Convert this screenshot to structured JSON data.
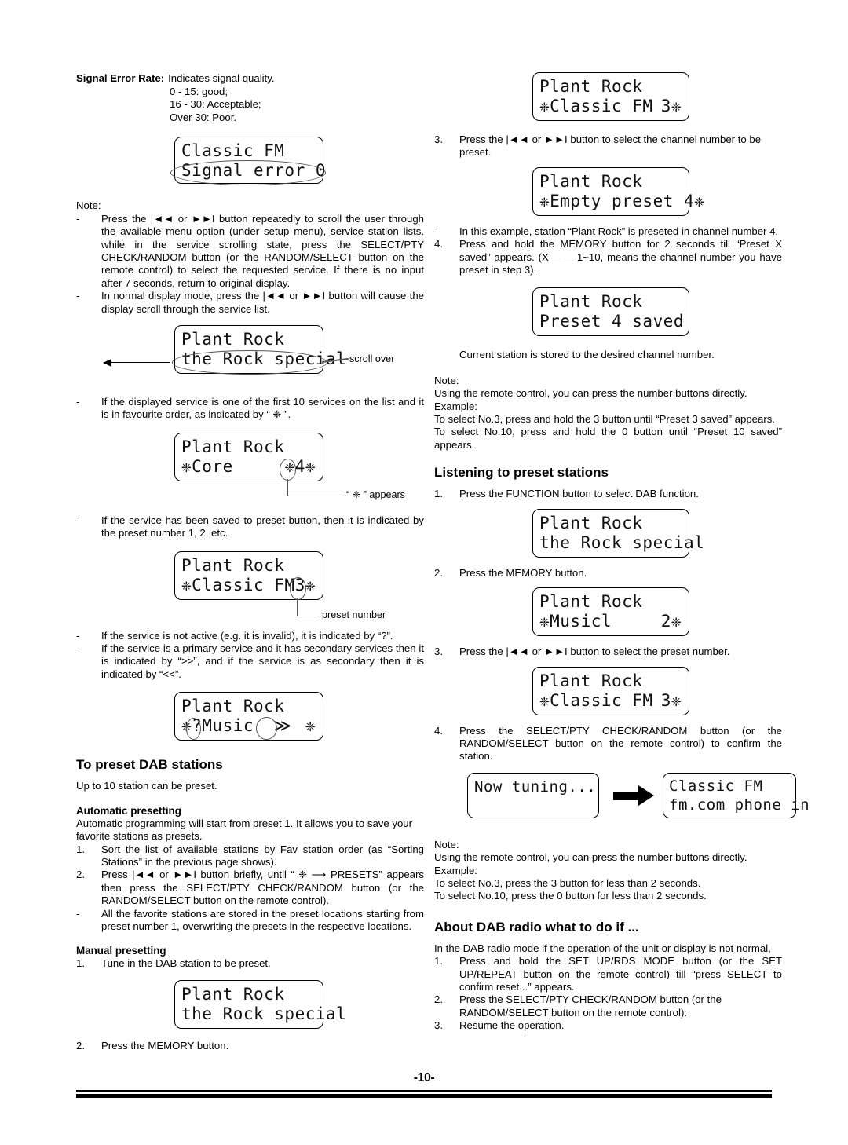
{
  "page": {
    "number": "-10-"
  },
  "left": {
    "signal_error": {
      "term": "Signal Error Rate:",
      "def_line1": "Indicates signal quality.",
      "def_line2": "0 - 15: good;",
      "def_line3": "16 - 30: Acceptable;",
      "def_line4": "Over 30: Poor."
    },
    "lcd_signal_error": {
      "line1": "Classic FM",
      "line2": "Signal error 0"
    },
    "note_label": "Note:",
    "note_items": [
      {
        "marker": "-",
        "text": "Press the |◄◄ or ►►I button repeatedly to scroll the user through the available menu option (under setup menu), service station lists. while in the service scrolling state, press the SELECT/PTY CHECK/RANDOM button (or the RANDOM/SELECT button on the remote control) to select the requested service. If there is no input after 7 seconds, return to original display."
      },
      {
        "marker": "-",
        "text": "In normal display mode, press the |◄◄ or ►►I  button will cause the display scroll through the service list."
      }
    ],
    "lcd_scroll": {
      "line1": "Plant Rock",
      "line2": "the Rock special",
      "callout": "scroll over"
    },
    "bullet_fav": {
      "marker": "-",
      "text": "If the displayed service is one of the first 10 services on the list and it is in favourite order, as indicated by “ ❈ ”."
    },
    "lcd_core": {
      "line1": "Plant Rock",
      "line2": "❈Core",
      "right": "❈4❈",
      "callout": "“ ❈ ” appears"
    },
    "bullet_preset": {
      "marker": "-",
      "text": "If the service has been saved to preset button, then it is indicated by the preset number 1, 2, etc."
    },
    "lcd_preset3": {
      "line1": "Plant Rock",
      "line2": "❈Classic FM",
      "right": "3❈",
      "callout": "preset number"
    },
    "bullet_inactive": {
      "marker": "-",
      "text": "If the service is not active (e.g. it is invalid), it is indicated by “?”."
    },
    "bullet_primary": {
      "marker": "-",
      "text": "If the service is a primary service and it has secondary services then it is indicated by “>>”, and if the service is as secondary then it is indicated by “<<”."
    },
    "lcd_music": {
      "line1": "Plant Rock",
      "line2": "❈?Music",
      "mid": "≫",
      "right": "❈"
    },
    "heading_preset": "To preset DAB stations",
    "preset_intro": "Up to 10 station can be preset.",
    "heading_auto": "Automatic presetting",
    "auto_intro": "Automatic programming will start from preset 1. It allows you to save your favorite stations as presets.",
    "auto_steps": [
      {
        "marker": "1.",
        "text": "Sort the list of available stations by Fav station order (as “Sorting Stations” in the previous page shows)."
      },
      {
        "marker": "2.",
        "text": "Press |◄◄ or ►►I button briefly, until “ ❈ ⟶ PRESETS” appears then press the SELECT/PTY CHECK/RANDOM button (or the RANDOM/SELECT button on the remote control)."
      },
      {
        "marker": "-",
        "text": "All the favorite stations are stored in the preset locations starting from preset number 1, overwriting the presets in the respective locations."
      }
    ],
    "heading_manual": "Manual presetting",
    "manual_step1": {
      "marker": "1.",
      "text": "Tune in the DAB station to be preset."
    },
    "lcd_manual": {
      "line1": "Plant Rock",
      "line2": "the Rock special"
    },
    "manual_step2": {
      "marker": "2.",
      "text": "Press the MEMORY button."
    }
  },
  "right": {
    "lcd_classic3": {
      "line1": "Plant Rock",
      "line2": "❈Classic FM",
      "right": "3❈"
    },
    "step3": {
      "marker": "3.",
      "text": "Press the |◄◄ or ►►I button to select the channel number to be preset."
    },
    "lcd_empty4": {
      "line1": "Plant Rock",
      "line2": "❈Empty preset 4❈"
    },
    "bullet_example": {
      "marker": "-",
      "text": "In this example, station “Plant Rock” is preseted in channel number 4."
    },
    "step4": {
      "marker": "4.",
      "text": "Press and hold the MEMORY button for 2 seconds till “Preset X saved” appears. (X —— 1~10, means the channel number you have preset in step 3)."
    },
    "lcd_saved": {
      "line1": "Plant Rock",
      "line2": "Preset 4 saved"
    },
    "stored_text": "Current station is stored to the desired channel number.",
    "note_label": "Note:",
    "note_lines": [
      "Using the remote control, you can press the number buttons directly.",
      "Example:",
      "To select No.3, press and hold the 3 button until “Preset 3 saved” appears."
    ],
    "note_justified": "To select No.10, press and hold the 0 button until “Preset 10 saved” appears.",
    "heading_listening": "Listening to preset stations",
    "listen_step1": {
      "marker": "1.",
      "text": "Press the FUNCTION button to select DAB function."
    },
    "lcd_listen1": {
      "line1": "Plant Rock",
      "line2": "the Rock special"
    },
    "listen_step2": {
      "marker": "2.",
      "text": "Press the MEMORY button."
    },
    "lcd_listen2": {
      "line1": "Plant Rock",
      "line2": "❈Musicl",
      "right": "2❈"
    },
    "listen_step3": {
      "marker": "3.",
      "text": "Press the |◄◄ or ►►I button to select the preset number."
    },
    "lcd_listen3": {
      "line1": "Plant Rock",
      "line2": "❈Classic FM",
      "right": "3❈"
    },
    "listen_step4": {
      "marker": "4.",
      "text": "Press the SELECT/PTY CHECK/RANDOM button (or the RANDOM/SELECT button on the remote control) to confirm the station."
    },
    "lcd_tuning": {
      "line1": "Now tuning..."
    },
    "lcd_tuned": {
      "line1": "Classic FM",
      "line2": "fm.com phone in"
    },
    "note2_label": "Note:",
    "note2_lines": [
      "Using the remote control, you can press the number buttons directly.",
      "Example:",
      "To select No.3, press the 3 button for less than 2 seconds.",
      "To select No.10, press the 0 button for less than 2 seconds."
    ],
    "heading_about": "About DAB radio what to do if ...",
    "about_intro": "In the DAB radio mode if the operation of the unit or display is not normal,",
    "about_steps": [
      {
        "marker": "1.",
        "text": "Press and hold the SET UP/RDS MODE button (or the SET UP/REPEAT button on the remote control) till “press SELECT to confirm reset...” appears."
      },
      {
        "marker": "2.",
        "text": "Press the SELECT/PTY CHECK/RANDOM button (or the RANDOM/SELECT button on the remote control)."
      },
      {
        "marker": "3.",
        "text": "Resume the operation."
      }
    ]
  }
}
